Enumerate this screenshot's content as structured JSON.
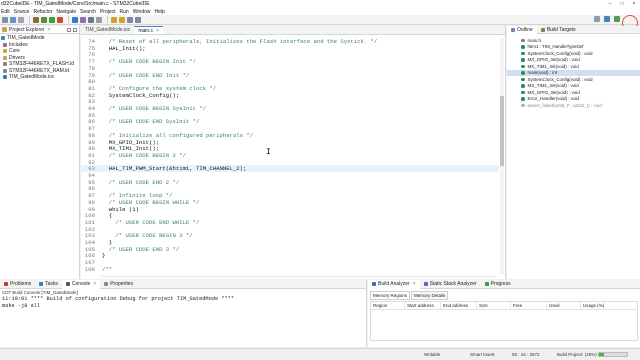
{
  "window": {
    "title": "d32CubeIDE - TIM_GatedMode/Core/Src/main.c - STM32CubeIDE",
    "controls": [
      "–",
      "□",
      "×"
    ]
  },
  "menu": [
    "Edit",
    "Source",
    "Refactor",
    "Navigate",
    "Search",
    "Project",
    "Run",
    "Window",
    "Help"
  ],
  "explorer": {
    "tab_label": "Project Explorer",
    "tab_close": "×",
    "items": [
      {
        "label": "TIM_GatedMode",
        "icon": "project-icon",
        "level": 0
      },
      {
        "label": "Includes",
        "icon": "includes-icon",
        "level": 1
      },
      {
        "label": "Core",
        "icon": "folder-icon",
        "level": 1
      },
      {
        "label": "Drivers",
        "icon": "folder-icon",
        "level": 1
      },
      {
        "label": "STM32F446RETX_FLASH.ld",
        "icon": "linker-file-icon",
        "level": 1
      },
      {
        "label": "STM32F446RETX_RAM.ld",
        "icon": "linker-file-icon",
        "level": 1
      },
      {
        "label": "TIM_GatedMode.ioc",
        "icon": "ioc-file-icon",
        "level": 1
      }
    ]
  },
  "editor": {
    "tabs": [
      {
        "label": "TIM_GatedMode.ioc",
        "active": false
      },
      {
        "label": "main.c",
        "active": true
      }
    ],
    "lines": [
      {
        "n": "74",
        "text": "  /* Reset of all peripherals, Initializes the Flash interface and the Systick. */",
        "kind": "cmt"
      },
      {
        "n": "75",
        "text": "  HAL_Init();",
        "kind": "code"
      },
      {
        "n": "76",
        "text": "",
        "kind": "code"
      },
      {
        "n": "77",
        "text": "  /* USER CODE BEGIN Init */",
        "kind": "cmt"
      },
      {
        "n": "78",
        "text": "",
        "kind": "code"
      },
      {
        "n": "79",
        "text": "  /* USER CODE END Init */",
        "kind": "cmt"
      },
      {
        "n": "80",
        "text": "",
        "kind": "code"
      },
      {
        "n": "81",
        "text": "  /* Configure the system clock */",
        "kind": "cmt"
      },
      {
        "n": "82",
        "text": "  SystemClock_Config();",
        "kind": "code"
      },
      {
        "n": "83",
        "text": "",
        "kind": "code"
      },
      {
        "n": "84",
        "text": "  /* USER CODE BEGIN SysInit */",
        "kind": "cmt"
      },
      {
        "n": "85",
        "text": "",
        "kind": "code"
      },
      {
        "n": "86",
        "text": "  /* USER CODE END SysInit */",
        "kind": "cmt"
      },
      {
        "n": "87",
        "text": "",
        "kind": "code"
      },
      {
        "n": "88",
        "text": "  /* Initialize all configured peripherals */",
        "kind": "cmt"
      },
      {
        "n": "89",
        "text": "  MX_GPIO_Init();",
        "kind": "code"
      },
      {
        "n": "90",
        "text": "  MX_TIM1_Init();",
        "kind": "code"
      },
      {
        "n": "91",
        "text": "  /* USER CODE BEGIN 2 */",
        "kind": "cmt"
      },
      {
        "n": "92",
        "text": "",
        "kind": "code"
      },
      {
        "n": "93",
        "text": "  HAL_TIM_PWM_Start(&htim1, TIM_CHANNEL_2);",
        "kind": "code",
        "highlight": true
      },
      {
        "n": "94",
        "text": "",
        "kind": "code"
      },
      {
        "n": "95",
        "text": "  /* USER CODE END 2 */",
        "kind": "cmt"
      },
      {
        "n": "96",
        "text": "",
        "kind": "code"
      },
      {
        "n": "97",
        "text": "  /* Infinite loop */",
        "kind": "cmt"
      },
      {
        "n": "98",
        "text": "  /* USER CODE BEGIN WHILE */",
        "kind": "cmt"
      },
      {
        "n": "99",
        "text": "  while (1)",
        "kind": "code"
      },
      {
        "n": "100",
        "text": "  {",
        "kind": "code"
      },
      {
        "n": "101",
        "text": "    /* USER CODE END WHILE */",
        "kind": "cmt"
      },
      {
        "n": "102",
        "text": "",
        "kind": "code"
      },
      {
        "n": "103",
        "text": "    /* USER CODE BEGIN 3 */",
        "kind": "cmt"
      },
      {
        "n": "104",
        "text": "  }",
        "kind": "code"
      },
      {
        "n": "105",
        "text": "  /* USER CODE END 3 */",
        "kind": "cmt"
      },
      {
        "n": "106",
        "text": "}",
        "kind": "code"
      },
      {
        "n": "107",
        "text": "",
        "kind": "code"
      },
      {
        "n": "108",
        "text": "/**",
        "kind": "cmt"
      }
    ]
  },
  "outline": {
    "tabs": [
      {
        "label": "Outline",
        "active": true
      },
      {
        "label": "Build Targets",
        "active": false
      }
    ],
    "items": [
      {
        "label": "main.h",
        "color": "#7a7a7a",
        "selected": false,
        "grey": false
      },
      {
        "label": "htim1 : TIM_HandleTypeDef",
        "color": "#2e8b57",
        "selected": false,
        "grey": false
      },
      {
        "label": "SystemClock_Config(void) : void",
        "color": "#2e8b57",
        "selected": false,
        "grey": false
      },
      {
        "label": "MX_GPIO_Init(void) : void",
        "color": "#2e8b57",
        "selected": false,
        "grey": false
      },
      {
        "label": "MX_TIM1_Init(void) : void",
        "color": "#2e8b57",
        "selected": false,
        "grey": false
      },
      {
        "label": "main(void) : int",
        "color": "#2e8b57",
        "selected": true,
        "grey": false
      },
      {
        "label": "SystemClock_Config(void) : void",
        "color": "#2e8b57",
        "selected": false,
        "grey": false
      },
      {
        "label": "MX_TIM1_Init(void) : void",
        "color": "#2e8b57",
        "selected": false,
        "grey": false
      },
      {
        "label": "MX_GPIO_Init(void) : void",
        "color": "#2e8b57",
        "selected": false,
        "grey": false
      },
      {
        "label": "Error_Handler(void) : void",
        "color": "#2e8b57",
        "selected": false,
        "grey": false
      },
      {
        "label": "assert_failed(uint8_t*, uint32_t) : void",
        "color": "#b0b0b0",
        "selected": false,
        "grey": true
      }
    ]
  },
  "console": {
    "tabs": [
      {
        "label": "Problems",
        "active": false
      },
      {
        "label": "Tasks",
        "active": false
      },
      {
        "label": "Console",
        "active": true
      },
      {
        "label": "Properties",
        "active": false
      }
    ],
    "subtitle": "CDT Build Console [TIM_GatedMode]",
    "lines": [
      "11:19:01 **** Build of configuration Debug for project TIM_GatedMode ****",
      "make -j8 all"
    ]
  },
  "analyzer": {
    "tabs": [
      {
        "label": "Build Analyzer",
        "active": true
      },
      {
        "label": "Static Stack Analyzer",
        "active": false
      },
      {
        "label": "Progress",
        "active": false
      }
    ],
    "subtabs": [
      {
        "label": "Memory Regions",
        "active": true
      },
      {
        "label": "Memory Details",
        "active": false
      }
    ],
    "columns": [
      "Region",
      "Start address",
      "End address",
      "Size",
      "Free",
      "Used",
      "Usage (%)"
    ]
  },
  "status": {
    "mode": "Writable",
    "insert": "Smart Insert",
    "position": "93 : 44 : 2572",
    "build": "Build Project: (19%)",
    "progress_pct": 19
  },
  "colors": {
    "comment": "#3f7f5f",
    "accent": "#4a7fd0",
    "highlight_line": "#e8f2fe",
    "selection": "#cfe0f5"
  }
}
